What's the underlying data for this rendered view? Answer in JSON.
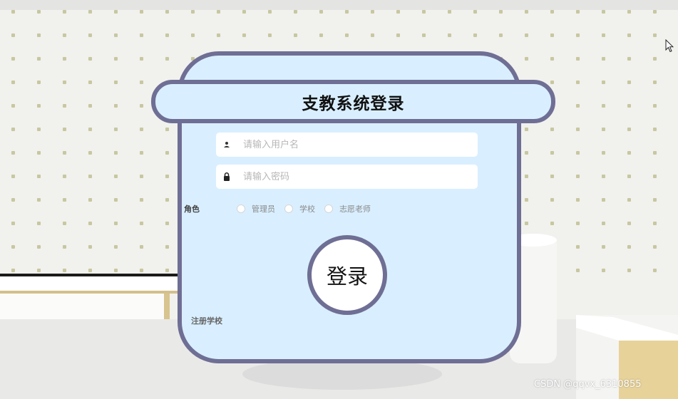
{
  "login": {
    "title": "支教系统登录",
    "username_placeholder": "请输入用户名",
    "password_placeholder": "请输入密码",
    "role_label": "角色",
    "roles": [
      "管理员",
      "学校",
      "志愿老师"
    ],
    "submit_label": "登录",
    "register_link": "注册学校"
  },
  "watermark": "CSDN @qqvx_6310855",
  "icons": {
    "username": "user-icon",
    "password": "lock-icon",
    "cursor": "mouse-cursor-icon"
  },
  "colors": {
    "card_fill": "#d9efff",
    "card_border": "#6f6e94",
    "input_fill": "#ffffff"
  }
}
